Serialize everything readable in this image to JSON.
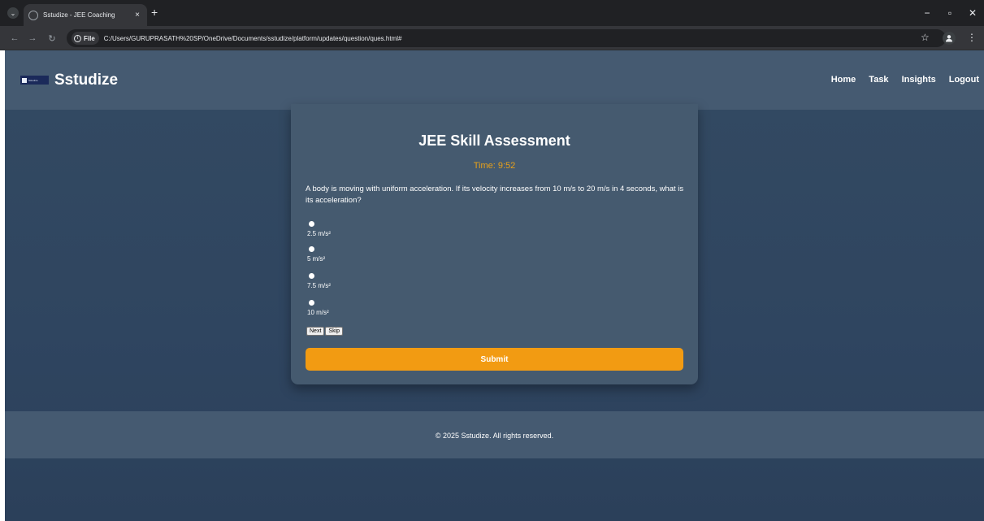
{
  "browser": {
    "tab_title": "Sstudize - JEE Coaching",
    "tab_close": "×",
    "new_tab": "+",
    "file_chip": "File",
    "url": "C:/Users/GURUPRASATH%20SP/OneDrive/Documents/sstudize/platform/updates/question/ques.html#",
    "window_controls": {
      "minimize": "−",
      "restore": "▫",
      "close": "✕"
    }
  },
  "header": {
    "logo_text": "Sstudize",
    "brand": "Sstudize",
    "nav": [
      "Home",
      "Task",
      "Insights",
      "Logout"
    ]
  },
  "assessment": {
    "title": "JEE Skill Assessment",
    "timer": "Time: 9:52",
    "question": "A body is moving with uniform acceleration. If its velocity increases from 10 m/s to 20 m/s in 4 seconds, what is its acceleration?",
    "options": [
      "2.5 m/s²",
      "5 m/s²",
      "7.5 m/s²",
      "10 m/s²"
    ],
    "next_label": "Next",
    "skip_label": "Skip",
    "submit_label": "Submit"
  },
  "footer": {
    "copyright": "© 2025 Sstudize. All rights reserved."
  },
  "colors": {
    "accent": "#f29b12",
    "timer": "#e9a21a",
    "header_bg": "#455a71",
    "page_bg": "#334a62",
    "card_bg": "#455a6f"
  }
}
